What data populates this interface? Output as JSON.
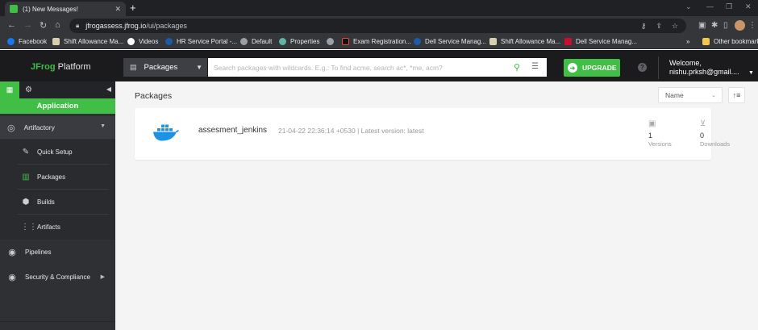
{
  "browser": {
    "tab_title": "(1) New Messages!",
    "tab_close": "✕",
    "new_tab": "+",
    "window_controls": [
      "⌄",
      "—",
      "❐",
      "✕"
    ],
    "url_host": "jfrogassess.jfrog.io",
    "url_path": "/ui/packages",
    "bookmarks": [
      "Facebook",
      "Shift Allowance Ma...",
      "Videos",
      "HR Service Portal -...",
      "Default",
      "Properties",
      "",
      "Exam Registration...",
      "Dell Service Manag...",
      "Shift Allowance Ma...",
      "Dell Service Manag..."
    ],
    "more_bookmarks": "»",
    "other_bookmarks": "Other bookmarks"
  },
  "header": {
    "logo_brand": "JFrog",
    "logo_rest": " Platform",
    "package_type": "Packages",
    "search_placeholder": "Search packages with wildcards. E.g.: To find acme, search ac*, *me, acm?",
    "upgrade_label": "UPGRADE",
    "help": "?",
    "welcome_line1": "Welcome,",
    "welcome_line2": "nishu.prksh@gmail...."
  },
  "sidebar": {
    "section": "Application",
    "artifactory": "Artifactory",
    "sub_items": [
      {
        "label": "Quick Setup",
        "icon": "wand-icon"
      },
      {
        "label": "Packages",
        "icon": "packages-icon"
      },
      {
        "label": "Builds",
        "icon": "builds-icon"
      },
      {
        "label": "Artifacts",
        "icon": "artifacts-icon"
      }
    ],
    "pipelines": "Pipelines",
    "security": "Security & Compliance"
  },
  "main": {
    "title": "Packages",
    "sort_by": "Name",
    "package": {
      "name": "assesment_jenkins",
      "meta": "21-04-22 22:36:14 +0530 | Latest version: latest",
      "versions_count": "1",
      "versions_label": "Versions",
      "downloads_count": "0",
      "downloads_label": "Downloads"
    }
  },
  "colors": {
    "accent": "#40be46",
    "sidebar_bg": "#2f3034",
    "header_bg": "#1b1b1d",
    "docker_blue": "#1d91e6"
  }
}
